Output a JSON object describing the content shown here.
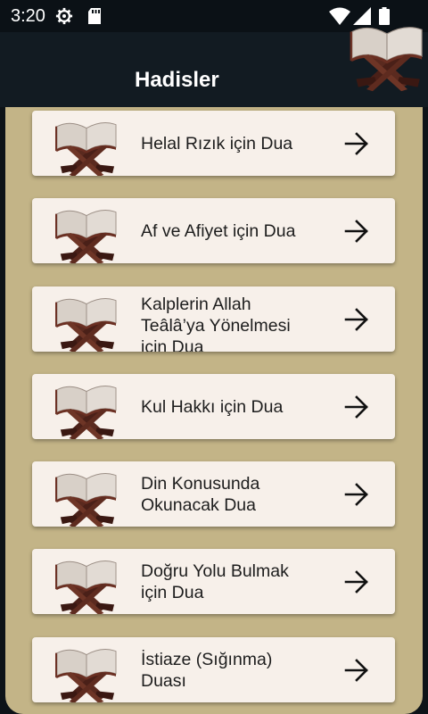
{
  "status_bar": {
    "time": "3:20",
    "icons": [
      "gear-icon",
      "sd-card-icon",
      "wifi-icon",
      "signal-icon",
      "battery-icon"
    ]
  },
  "app_bar": {
    "title": "Hadisler",
    "logo_icon": "quran-stand-icon"
  },
  "colors": {
    "status_bar": "#0b1116",
    "app_bar": "#121b22",
    "content_bg": "#c3b487",
    "card_bg": "#f7f0ea",
    "text": "#1d1d1d"
  },
  "items": [
    {
      "label": "Helal Rızık için Dua",
      "icon": "quran-stand-icon",
      "action_icon": "arrow-right-icon"
    },
    {
      "label": "Af ve Afiyet için Dua",
      "icon": "quran-stand-icon",
      "action_icon": "arrow-right-icon"
    },
    {
      "label": "Kalplerin Allah Teâlâ’ya Yönelmesi için Dua",
      "icon": "quran-stand-icon",
      "action_icon": "arrow-right-icon"
    },
    {
      "label": "Kul Hakkı için Dua",
      "icon": "quran-stand-icon",
      "action_icon": "arrow-right-icon"
    },
    {
      "label": "Din Konusunda Okunacak Dua",
      "icon": "quran-stand-icon",
      "action_icon": "arrow-right-icon"
    },
    {
      "label": "Doğru Yolu Bulmak için Dua",
      "icon": "quran-stand-icon",
      "action_icon": "arrow-right-icon"
    },
    {
      "label": "İstiaze (Sığınma) Duası",
      "icon": "quran-stand-icon",
      "action_icon": "arrow-right-icon"
    }
  ]
}
